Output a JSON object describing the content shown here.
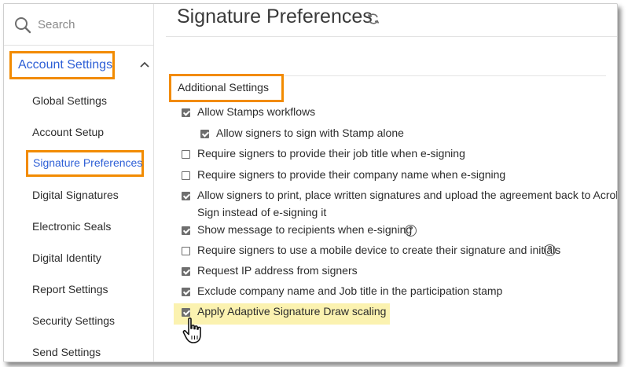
{
  "search": {
    "placeholder": "Search",
    "icon": "search-icon"
  },
  "sidebar": {
    "group_label": "Account Settings",
    "items": [
      {
        "label": "Global Settings"
      },
      {
        "label": "Account Setup"
      },
      {
        "label": "Signature Preferences",
        "active": true
      },
      {
        "label": "Digital Signatures"
      },
      {
        "label": "Electronic Seals"
      },
      {
        "label": "Digital Identity"
      },
      {
        "label": "Report Settings"
      },
      {
        "label": "Security Settings"
      },
      {
        "label": "Send Settings"
      }
    ]
  },
  "main": {
    "title": "Signature Preferences",
    "section_label": "Additional Settings",
    "options": [
      {
        "label": "Allow Stamps workflows",
        "checked": true
      },
      {
        "label": "Allow signers to sign with Stamp alone",
        "checked": true
      },
      {
        "label": "Require signers to provide their job title when e-signing",
        "checked": false
      },
      {
        "label": "Require signers to provide their company name when e-signing",
        "checked": false
      },
      {
        "label": "Allow signers to print, place written signatures and upload the agreement back to Acrobat",
        "label_line2": "Sign instead of e-signing it",
        "checked": true
      },
      {
        "label": "Show message to recipients when e-signing",
        "checked": true,
        "help": "?"
      },
      {
        "label": "Require signers to use a mobile device to create their signature and initials",
        "checked": false,
        "help": "?"
      },
      {
        "label": "Request IP address from signers",
        "checked": true
      },
      {
        "label": "Exclude company name and Job title in the participation stamp",
        "checked": true
      },
      {
        "label": "Apply Adaptive Signature Draw scaling",
        "checked": true
      }
    ]
  },
  "colors": {
    "accent_outline": "#f28b00",
    "link_blue": "#2d5fd6",
    "highlight": "#fbf2b0"
  }
}
